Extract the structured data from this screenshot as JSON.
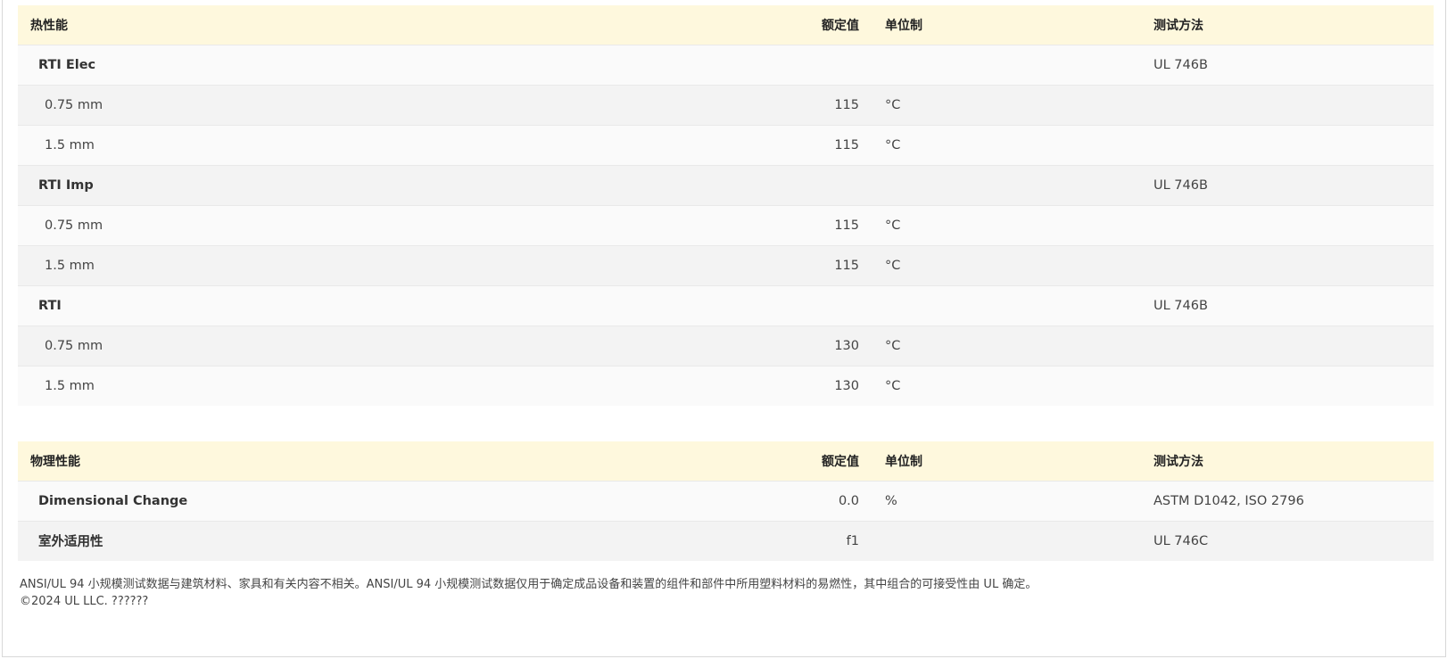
{
  "tables": [
    {
      "headers": {
        "name": "热性能",
        "value": "额定值",
        "unit": "单位制",
        "method": "测试方法"
      },
      "rows": [
        {
          "kind": "group",
          "name": "RTI Elec",
          "value": "",
          "unit": "",
          "method": "UL 746B"
        },
        {
          "kind": "sub",
          "name": "0.75 mm",
          "value": "115",
          "unit": "°C",
          "method": ""
        },
        {
          "kind": "sub",
          "name": "1.5 mm",
          "value": "115",
          "unit": "°C",
          "method": ""
        },
        {
          "kind": "group",
          "name": "RTI Imp",
          "value": "",
          "unit": "",
          "method": "UL 746B"
        },
        {
          "kind": "sub",
          "name": "0.75 mm",
          "value": "115",
          "unit": "°C",
          "method": ""
        },
        {
          "kind": "sub",
          "name": "1.5 mm",
          "value": "115",
          "unit": "°C",
          "method": ""
        },
        {
          "kind": "group",
          "name": "RTI",
          "value": "",
          "unit": "",
          "method": "UL 746B"
        },
        {
          "kind": "sub",
          "name": "0.75 mm",
          "value": "130",
          "unit": "°C",
          "method": ""
        },
        {
          "kind": "sub",
          "name": "1.5 mm",
          "value": "130",
          "unit": "°C",
          "method": ""
        }
      ]
    },
    {
      "headers": {
        "name": "物理性能",
        "value": "额定值",
        "unit": "单位制",
        "method": "测试方法"
      },
      "rows": [
        {
          "kind": "group",
          "name": "Dimensional Change",
          "value": "0.0",
          "unit": "%",
          "method": "ASTM D1042, ISO 2796"
        },
        {
          "kind": "group",
          "name": "室外适用性",
          "value": "f1",
          "unit": "",
          "method": "UL 746C"
        }
      ]
    }
  ],
  "footer": {
    "disclaimer": "ANSI/UL 94 小规模测试数据与建筑材料、家具和有关内容不相关。ANSI/UL 94 小规模测试数据仅用于确定成品设备和装置的组件和部件中所用塑料材料的易燃性，其中组合的可接受性由 UL 确定。",
    "copyright": "©2024 UL LLC. ??????"
  }
}
